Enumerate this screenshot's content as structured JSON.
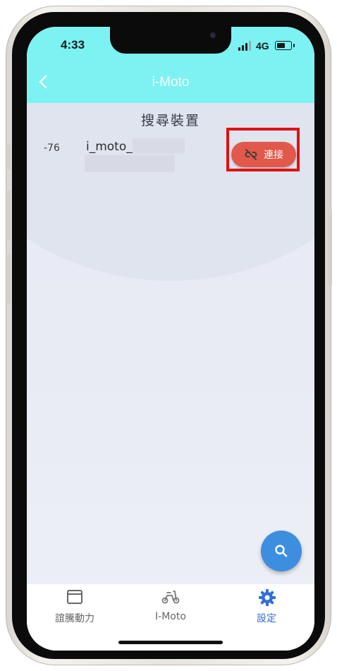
{
  "status_bar": {
    "time": "4:33",
    "network": "4G",
    "battery_level": 0.7
  },
  "app_bar": {
    "title": "i-Moto",
    "back_icon": "chevron-left-icon"
  },
  "search": {
    "title": "搜尋裝置",
    "devices": [
      {
        "rssi": "-76",
        "name": "i_moto_",
        "action_label": "連接",
        "action_icon": "link-off-icon"
      }
    ]
  },
  "fab": {
    "icon": "search-icon"
  },
  "bottom_nav": {
    "items": [
      {
        "label": "誼騰動力",
        "icon": "window-icon",
        "active": false
      },
      {
        "label": "I-Moto",
        "icon": "scooter-icon",
        "active": false
      },
      {
        "label": "設定",
        "icon": "gear-icon",
        "active": true
      }
    ]
  },
  "colors": {
    "app_bar": "#7cf2f2",
    "connect_button": "#e0594a",
    "highlight_box": "#e11010",
    "fab": "#3e8ee0",
    "nav_active": "#2f6fd6",
    "nav_inactive": "#666666"
  }
}
